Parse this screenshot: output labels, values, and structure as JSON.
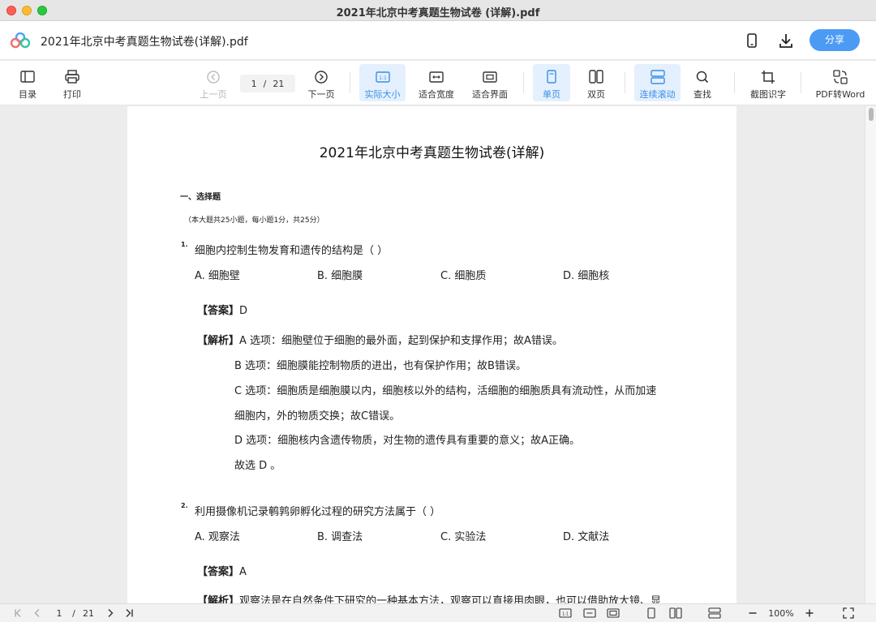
{
  "window": {
    "title": "2021年北京中考真题生物试卷 (详解).pdf"
  },
  "header": {
    "doc_title": "2021年北京中考真题生物试卷(详解).pdf",
    "share_label": "分享"
  },
  "toolbar": {
    "toc": "目录",
    "print": "打印",
    "prev": "上一页",
    "page_current": "1",
    "page_sep": "/",
    "page_total": "21",
    "next": "下一页",
    "actual_size": "实际大小",
    "fit_width": "适合宽度",
    "fit_screen": "适合界面",
    "single_page": "单页",
    "double_page": "双页",
    "continuous": "连续滚动",
    "find": "查找",
    "ocr": "截图识字",
    "pdf_to_word": "PDF转Word"
  },
  "document": {
    "title": "2021年北京中考真题生物试卷(详解)",
    "section_title": "一、选择题",
    "section_note": "（本大题共25小题，每小题1分，共25分）",
    "questions": [
      {
        "number": "1.",
        "text": "细胞内控制生物发育和遗传的结构是（    ）",
        "options": [
          "A. 细胞壁",
          "B. 细胞膜",
          "C. 细胞质",
          "D. 细胞核"
        ],
        "answer_label": "【答案】",
        "answer": "D",
        "explanation_label": "【解析】",
        "explanation": [
          "A 选项：细胞壁位于细胞的最外面，起到保护和支撑作用；故A错误。",
          "B 选项：细胞膜能控制物质的进出，也有保护作用；故B错误。",
          "C 选项：细胞质是细胞膜以内，细胞核以外的结构，活细胞的细胞质具有流动性，从而加速",
          "细胞内，外的物质交换；故C错误。",
          "D 选项：细胞核内含遗传物质，对生物的遗传具有重要的意义；故A正确。",
          "故选 D 。"
        ]
      },
      {
        "number": "2.",
        "text": "利用摄像机记录鹌鹑卵孵化过程的研究方法属于（    ）",
        "options": [
          "A. 观察法",
          "B. 调查法",
          "C. 实验法",
          "D. 文献法"
        ],
        "answer_label": "【答案】",
        "answer": "A",
        "explanation_label": "【解析】",
        "explanation": [
          "观察法是在自然条件下研究的一种基本方法，观察可以直接用肉眼，也可以借助放大镜、显"
        ]
      }
    ]
  },
  "statusbar": {
    "page_current": "1",
    "page_sep": "/",
    "page_total": "21",
    "zoom": "100%"
  },
  "colors": {
    "accent": "#4b9bf5",
    "active_bg": "#e4f0fd",
    "page_bg": "#ffffff",
    "canvas_bg": "#ececec"
  }
}
